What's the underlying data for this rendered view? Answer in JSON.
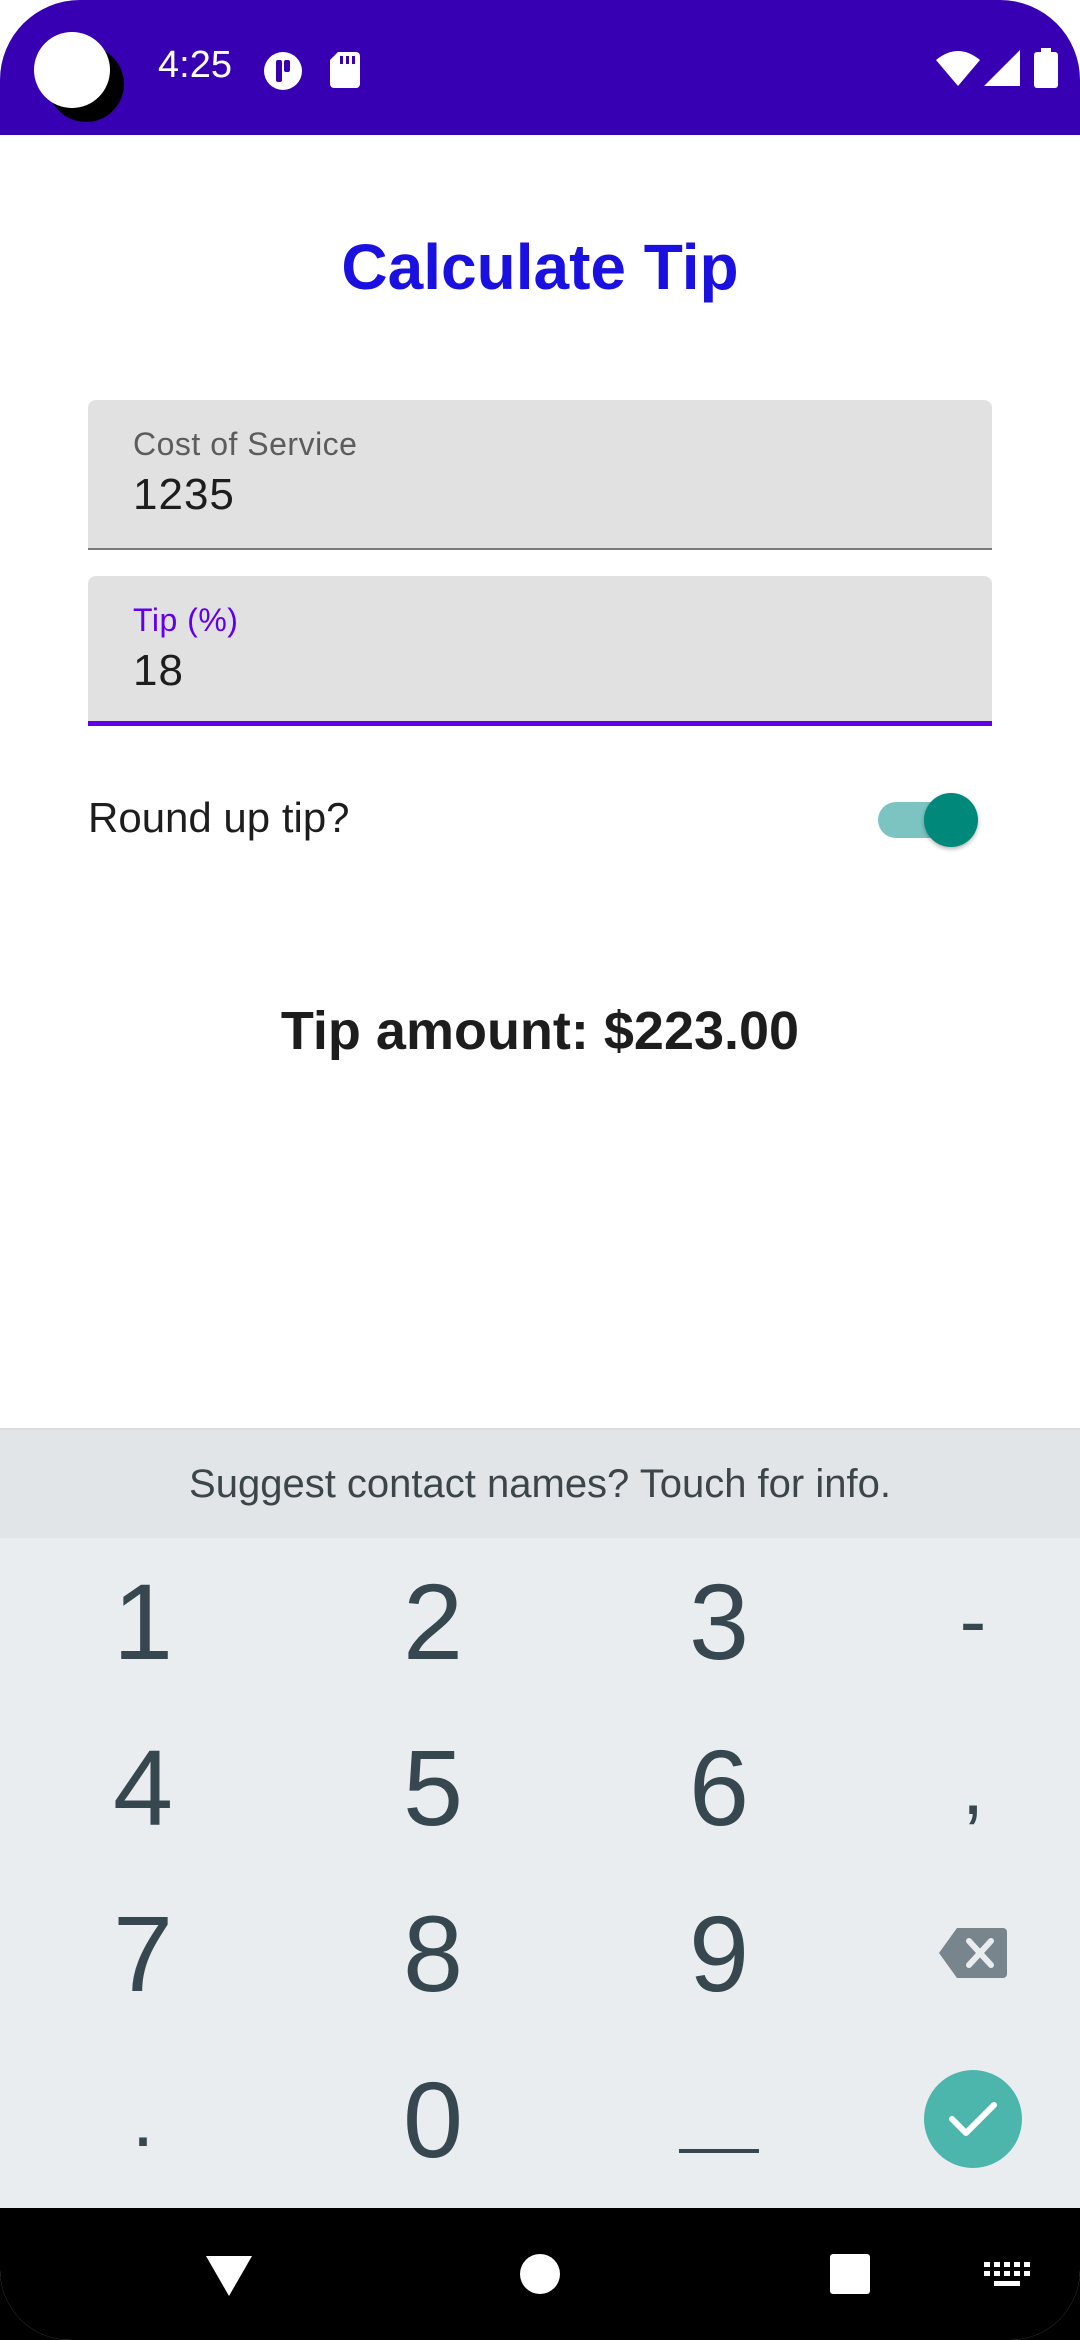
{
  "status_bar": {
    "time": "4:25",
    "icons": [
      "camera-cutout",
      "info-badge-icon",
      "sd-card-icon",
      "wifi-icon",
      "signal-icon",
      "battery-icon"
    ],
    "background": "#3700b3"
  },
  "app": {
    "title": "Calculate Tip",
    "title_color": "#1a10e0",
    "cost_field": {
      "label": "Cost of Service",
      "value": "1235"
    },
    "tip_field": {
      "label": "Tip (%)",
      "value": "18",
      "focused": true,
      "accent": "#6200ee"
    },
    "round_up": {
      "label": "Round up tip?",
      "checked": true,
      "color": "#00897b"
    },
    "tip_amount": "Tip amount: $223.00"
  },
  "keyboard": {
    "suggestion": "Suggest contact names? Touch for info.",
    "rows": [
      [
        "1",
        "2",
        "3",
        "-"
      ],
      [
        "4",
        "5",
        "6",
        ","
      ],
      [
        "7",
        "8",
        "9",
        "backspace"
      ],
      [
        ".",
        "0",
        "_",
        "done"
      ]
    ],
    "done_color": "#4db6ac"
  },
  "nav_bar": {
    "buttons": [
      "back-icon",
      "home-icon",
      "recents-icon",
      "keyboard-switch-icon"
    ]
  }
}
